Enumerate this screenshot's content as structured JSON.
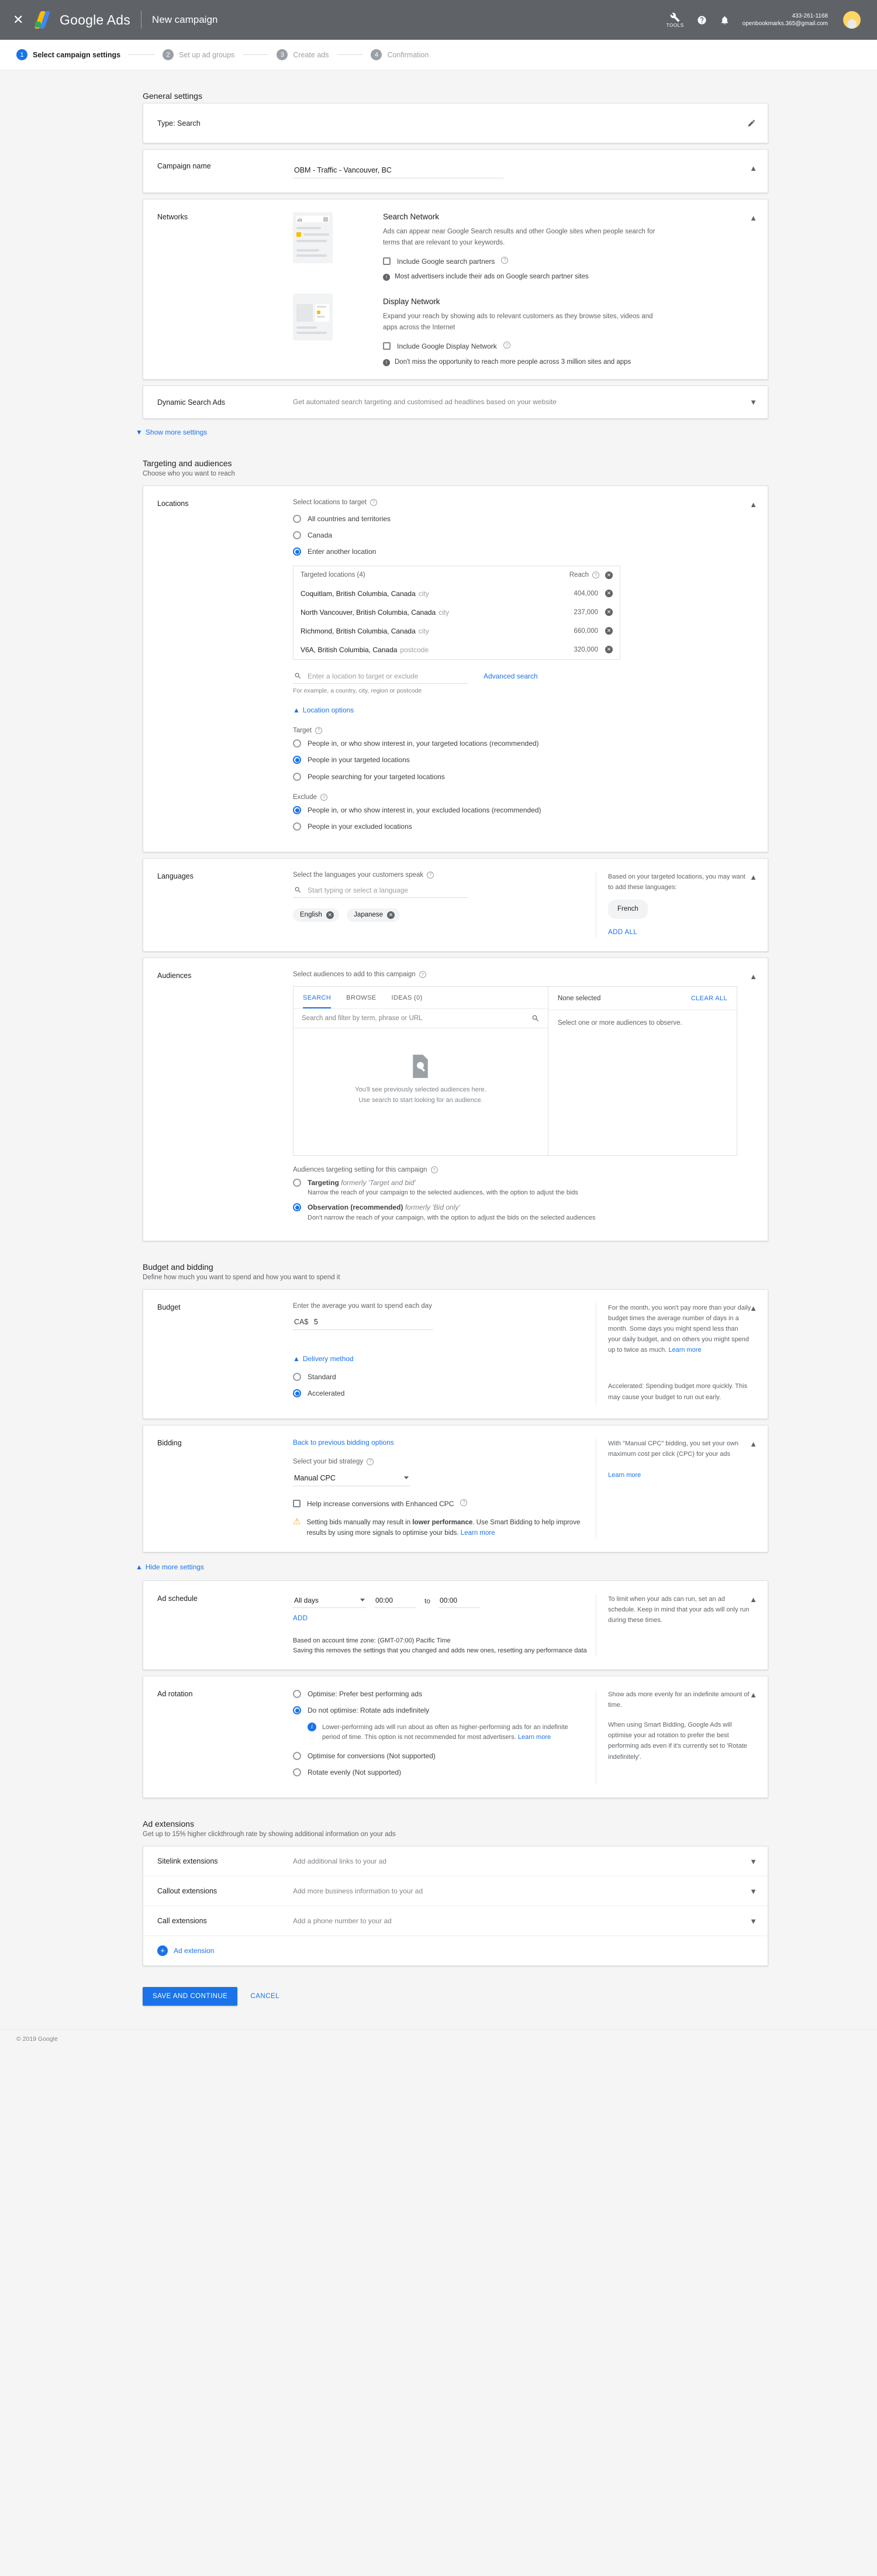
{
  "topbar": {
    "brand": "Google Ads",
    "page_label": "New campaign",
    "tools_label": "TOOLS",
    "account_number": "433-261-1168",
    "account_email": "openbookmarks.365@gmail.com"
  },
  "stepper": {
    "steps": [
      {
        "num": "1",
        "label": "Select campaign settings"
      },
      {
        "num": "2",
        "label": "Set up ad groups"
      },
      {
        "num": "3",
        "label": "Create ads"
      },
      {
        "num": "4",
        "label": "Confirmation"
      }
    ]
  },
  "general": {
    "title": "General settings",
    "type_row": {
      "text": "Type: Search"
    },
    "campaign_name": {
      "label": "Campaign name",
      "value": "OBM - Traffic - Vancouver, BC"
    },
    "networks": {
      "label": "Networks",
      "search": {
        "title": "Search Network",
        "desc": "Ads can appear near Google Search results and other Google sites when people search for terms that are relevant to your keywords.",
        "checkbox": "Include Google search partners",
        "note": "Most advertisers include their ads on Google search partner sites"
      },
      "display": {
        "title": "Display Network",
        "desc": "Expand your reach by showing ads to relevant customers as they browse sites, videos and apps across the Internet",
        "checkbox": "Include Google Display Network",
        "note": "Don't miss the opportunity to reach more people across 3 million sites and apps"
      }
    },
    "dynamic_search_ads": {
      "label": "Dynamic Search Ads",
      "desc": "Get automated search targeting and customised ad headlines based on your website"
    },
    "show_more": "Show more settings"
  },
  "targeting": {
    "title": "Targeting and audiences",
    "subtitle": "Choose who you want to reach",
    "locations": {
      "label": "Locations",
      "prompt": "Select locations to target",
      "options": [
        "All countries and territories",
        "Canada",
        "Enter another location"
      ],
      "selected_option": 2,
      "targeted_header": "Targeted locations (4)",
      "reach_header": "Reach",
      "targeted": [
        {
          "name": "Coquitlam, British Columbia, Canada",
          "type": "city",
          "reach": "404,000"
        },
        {
          "name": "North Vancouver, British Columbia, Canada",
          "type": "city",
          "reach": "237,000"
        },
        {
          "name": "Richmond, British Columbia, Canada",
          "type": "city",
          "reach": "660,000"
        },
        {
          "name": "V6A, British Columbia, Canada",
          "type": "postcode",
          "reach": "320,000"
        }
      ],
      "search_placeholder": "Enter a location to target or exclude",
      "advanced_search": "Advanced search",
      "hint": "For example, a country, city, region or postcode",
      "location_options_link": "Location options",
      "target_label": "Target",
      "target_options": [
        "People in, or who show interest in, your targeted locations (recommended)",
        "People in your targeted locations",
        "People searching for your targeted locations"
      ],
      "target_selected": 1,
      "exclude_label": "Exclude",
      "exclude_options": [
        "People in, or who show interest in, your excluded locations (recommended)",
        "People in your excluded locations"
      ],
      "exclude_selected": 0
    },
    "languages": {
      "label": "Languages",
      "prompt": "Select the languages your customers speak",
      "search_placeholder": "Start typing or select a language",
      "chips": [
        "English",
        "Japanese"
      ],
      "aside_text": "Based on your targeted locations, you may want to add these languages:",
      "suggested": "French",
      "add_all": "ADD ALL"
    },
    "audiences": {
      "label": "Audiences",
      "prompt": "Select audiences to add to this campaign",
      "tabs": [
        "SEARCH",
        "BROWSE",
        "IDEAS (0)"
      ],
      "active_tab": 0,
      "search_placeholder": "Search and filter by term, phrase or URL",
      "empty_line1": "You'll see previously selected audiences here.",
      "empty_line2": "Use search to start looking for an audience.",
      "none_selected": "None selected",
      "clear_all": "CLEAR ALL",
      "right_empty": "Select one or more audiences to observe.",
      "setting_label": "Audiences targeting setting for this campaign",
      "setting_options": [
        {
          "title": "Targeting",
          "formerly": "formerly 'Target and bid'",
          "desc": "Narrow the reach of your campaign to the selected audiences, with the option to adjust the bids"
        },
        {
          "title": "Observation (recommended)",
          "formerly": "formerly 'Bid only'",
          "desc": "Don't narrow the reach of your campaign, with the option to adjust the bids on the selected audiences"
        }
      ],
      "setting_selected": 1
    }
  },
  "budget": {
    "title": "Budget and bidding",
    "subtitle": "Define how much you want to spend and how you want to spend it",
    "budget_row": {
      "label": "Budget",
      "prompt": "Enter the average you want to spend each day",
      "currency": "CA$",
      "amount": "5",
      "aside": "For the month, you won't pay more than your daily budget times the average number of days in a month. Some days you might spend less than your daily budget, and on others you might spend up to twice as much.",
      "aside_link": "Learn more",
      "delivery_link": "Delivery method",
      "delivery_options": [
        "Standard",
        "Accelerated"
      ],
      "delivery_selected": 1,
      "delivery_aside": "Accelerated: Spending budget more quickly. This may cause your budget to run out early."
    },
    "bidding_row": {
      "label": "Bidding",
      "back_link": "Back to previous bidding options",
      "strategy_label": "Select your bid strategy",
      "strategy_value": "Manual CPC",
      "ecpc_checkbox": "Help increase conversions with Enhanced CPC",
      "warning_pre": "Setting bids manually may result in ",
      "warning_bold": "lower performance",
      "warning_post": ". Use Smart Bidding to help improve results by using more signals to optimise your bids. ",
      "warning_link": "Learn more",
      "aside": "With \"Manual CPC\" bidding, you set your own maximum cost per click (CPC) for your ads",
      "aside_link": "Learn more"
    },
    "hide_more": "Hide more settings"
  },
  "ad_schedule": {
    "label": "Ad schedule",
    "days": "All days",
    "start_time": "00:00",
    "to": "to",
    "end_time": "00:00",
    "add": "ADD",
    "note_line1": "Based on account time zone: (GMT-07:00) Pacific Time",
    "note_line2": "Saving this removes the settings that you changed and adds new ones, resetting any performance data",
    "aside": "To limit when your ads can run, set an ad schedule. Keep in mind that your ads will only run during these times."
  },
  "ad_rotation": {
    "label": "Ad rotation",
    "options": [
      "Optimise: Prefer best performing ads",
      "Do not optimise: Rotate ads indefinitely",
      "Optimise for conversions (Not supported)",
      "Rotate evenly (Not supported)"
    ],
    "selected": 1,
    "info_note": "Lower-performing ads will run about as often as higher-performing ads for an indefinite period of time. This option is not recommended for most advertisers.",
    "info_link": "Learn more",
    "aside_p1": "Show ads more evenly for an indefinite amount of time.",
    "aside_p2": "When using Smart Bidding, Google Ads will optimise your ad rotation to prefer the best performing ads even if it's currently set to 'Rotate indefinitely'."
  },
  "extensions": {
    "title": "Ad extensions",
    "subtitle": "Get up to 15% higher clickthrough rate by showing additional information on your ads",
    "rows": [
      {
        "name": "Sitelink extensions",
        "desc": "Add additional links to your ad"
      },
      {
        "name": "Callout extensions",
        "desc": "Add more business information to your ad"
      },
      {
        "name": "Call extensions",
        "desc": "Add a phone number to your ad"
      }
    ],
    "add_extension": "Ad extension"
  },
  "footer": {
    "save": "SAVE AND CONTINUE",
    "cancel": "CANCEL",
    "copyright": "© 2019 Google"
  }
}
